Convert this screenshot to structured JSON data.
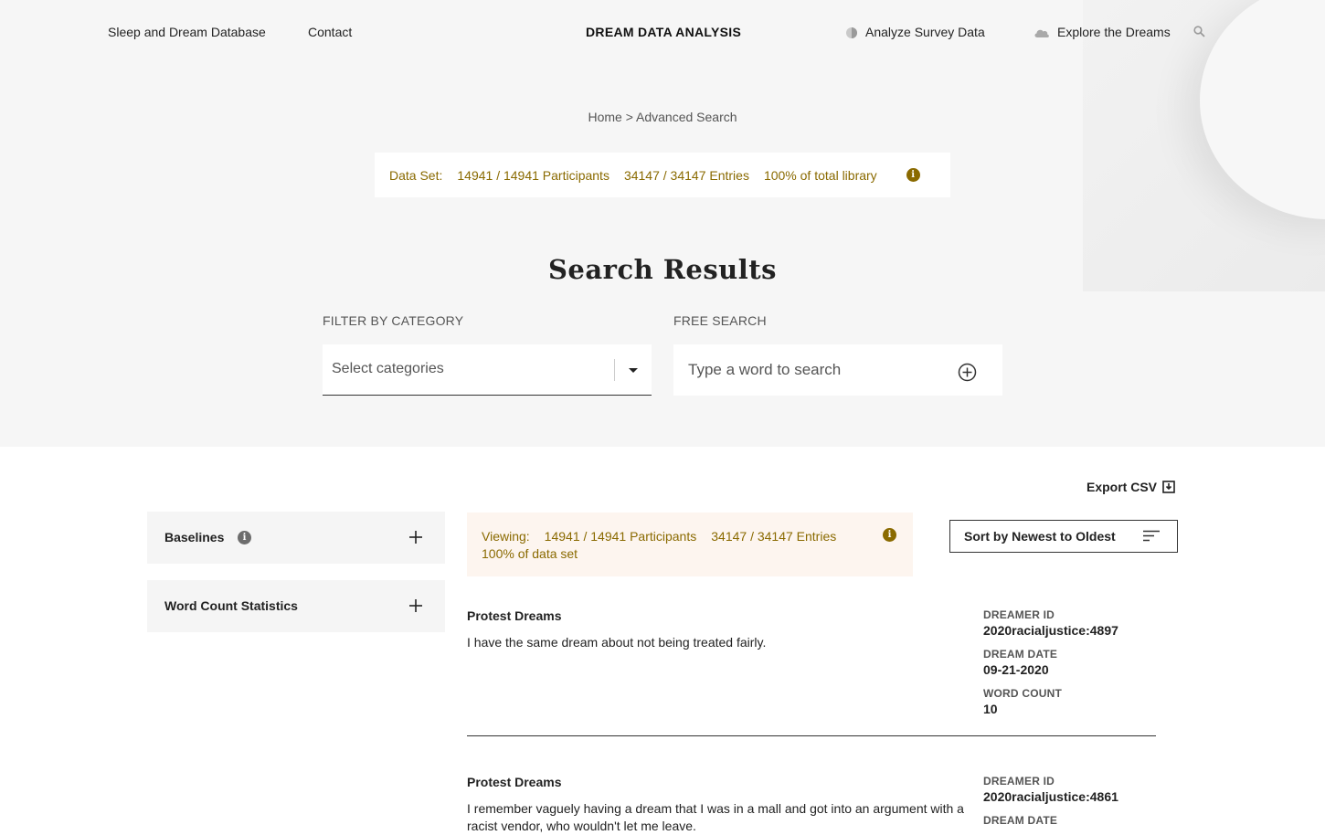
{
  "nav": {
    "left_links": [
      "Sleep and Dream Database",
      "Contact"
    ],
    "site_title": "DREAM DATA ANALYSIS",
    "analyze": "Analyze Survey Data",
    "explore": "Explore the Dreams"
  },
  "breadcrumb": "Home > Advanced Search",
  "dataset": {
    "label": "Data Set:",
    "participants": "14941 / 14941 Participants",
    "entries": "34147 / 34147 Entries",
    "percent": "100% of total library"
  },
  "page_title": "Search Results",
  "filter": {
    "label": "FILTER BY CATEGORY",
    "placeholder": "Select categories"
  },
  "free_search": {
    "label": "FREE SEARCH",
    "placeholder": "Type a word to search"
  },
  "export_label": "Export CSV",
  "accordions": [
    {
      "label": "Baselines"
    },
    {
      "label": "Word Count Statistics"
    }
  ],
  "viewing": {
    "label": "Viewing:",
    "participants": "14941 / 14941 Participants",
    "entries": "34147 / 34147 Entries",
    "percent": "100% of data set"
  },
  "sort_label": "Sort by Newest to Oldest",
  "meta_labels": {
    "dreamer_id": "DREAMER ID",
    "dream_date": "DREAM DATE",
    "word_count": "WORD COUNT"
  },
  "results": [
    {
      "category": "Protest Dreams",
      "text": "I have the same dream about not being treated fairly.",
      "dreamer_id": "2020racialjustice:4897",
      "dream_date": "09-21-2020",
      "word_count": "10"
    },
    {
      "category": "Protest Dreams",
      "text": "I remember vaguely having a dream that I was in a mall and got into an argument with a racist vendor, who wouldn't let me leave.",
      "dreamer_id": "2020racialjustice:4861"
    }
  ],
  "colors": {
    "accent_gold": "#8a6a00",
    "hero_bg": "#f6f6f6",
    "viewing_bg": "#fdf5ef"
  }
}
